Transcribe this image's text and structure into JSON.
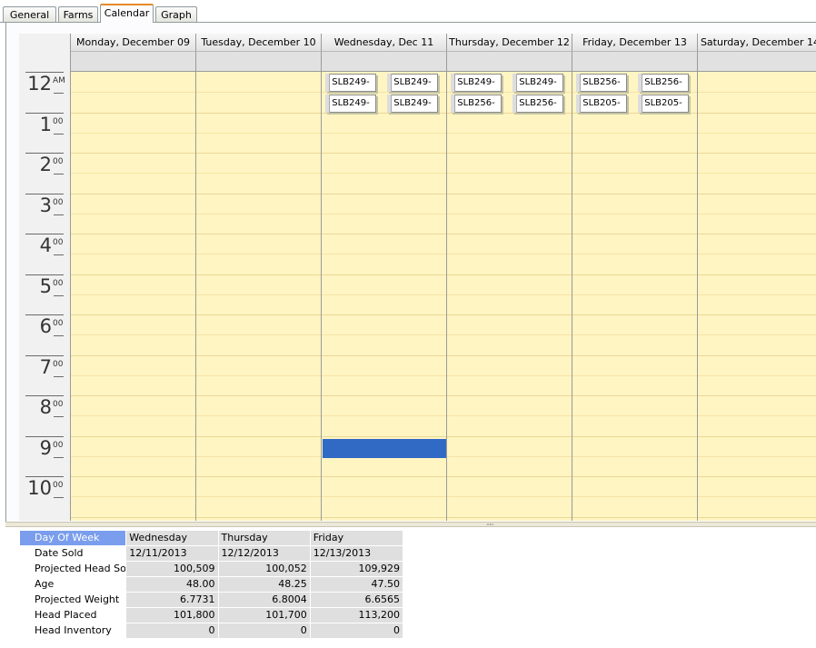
{
  "tabs": [
    {
      "label": "General",
      "active": false
    },
    {
      "label": "Farms",
      "active": false
    },
    {
      "label": "Calendar",
      "active": true
    },
    {
      "label": "Graph",
      "active": false
    }
  ],
  "calendar": {
    "days": [
      "Monday, December 09",
      "Tuesday, December 10",
      "Wednesday, Dec 11",
      "Thursday, December 12",
      "Friday, December 13",
      "Saturday, December 14"
    ],
    "hours": [
      {
        "num": "12",
        "suffix": "AM"
      },
      {
        "num": "1",
        "suffix": "00"
      },
      {
        "num": "2",
        "suffix": "00"
      },
      {
        "num": "3",
        "suffix": "00"
      },
      {
        "num": "4",
        "suffix": "00"
      },
      {
        "num": "5",
        "suffix": "00"
      },
      {
        "num": "6",
        "suffix": "00"
      },
      {
        "num": "7",
        "suffix": "00"
      },
      {
        "num": "8",
        "suffix": "00"
      },
      {
        "num": "9",
        "suffix": "00"
      },
      {
        "num": "10",
        "suffix": "00"
      }
    ],
    "appointments": {
      "wednesday": [
        "SLB249-",
        "SLB249-",
        "SLB249-",
        "SLB249-"
      ],
      "thursday": [
        "SLB249-",
        "SLB249-",
        "SLB256-",
        "SLB256-"
      ],
      "friday": [
        "SLB256-",
        "SLB256-",
        "SLB205-",
        "SLB205-"
      ]
    },
    "colors": {
      "workday": "#fff5c2",
      "selection": "#316ac5",
      "header": "#e2e2e2"
    }
  },
  "summary": {
    "columns": [
      "Wednesday",
      "Thursday",
      "Friday"
    ],
    "rows": [
      {
        "label": "Day Of Week",
        "values": [
          "Wednesday",
          "Thursday",
          "Friday"
        ]
      },
      {
        "label": "Date Sold",
        "values": [
          "12/11/2013",
          "12/12/2013",
          "12/13/2013"
        ]
      },
      {
        "label": "Projected Head Sold",
        "values": [
          "100,509",
          "100,052",
          "109,929"
        ]
      },
      {
        "label": "Age",
        "values": [
          "48.00",
          "48.25",
          "47.50"
        ]
      },
      {
        "label": "Projected Weight",
        "values": [
          "6.7731",
          "6.8004",
          "6.6565"
        ]
      },
      {
        "label": "Head Placed",
        "values": [
          "101,800",
          "101,700",
          "113,200"
        ]
      },
      {
        "label": "Head Inventory",
        "values": [
          "0",
          "0",
          "0"
        ]
      }
    ]
  }
}
